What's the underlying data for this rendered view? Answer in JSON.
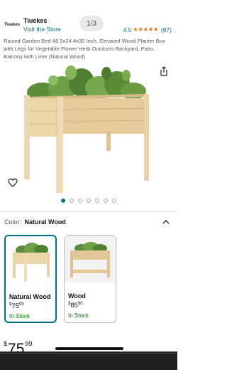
{
  "header": {
    "brand_logo_text": "Tiuekes",
    "brand_name": "Tiuekes",
    "visit_store": "Visit the Store",
    "image_counter": "1/3",
    "rating_value": "4.5",
    "rating_stars": 4.5,
    "rating_stars_glyphs": "★★★★★",
    "rating_count": "(87)"
  },
  "product": {
    "title": "Raised Garden Bed 48.5x24.4x30 Inch, Elevated Wood Planter Box with Legs for Vegetable Flower Herb Outdoors Backyard, Patio, Balcony with Liner (Natural Wood)"
  },
  "gallery": {
    "dot_count": 7,
    "active_index": 0
  },
  "color_selector": {
    "label": "Color:",
    "selected": "Natural Wood",
    "options": [
      {
        "name": "Natural Wood",
        "price_dollars": "75",
        "price_cents": "99",
        "currency": "$",
        "stock": "In Stock",
        "selected": true
      },
      {
        "name": "Wood",
        "price_dollars": "85",
        "price_cents": "90",
        "currency": "$",
        "stock": "In Stock",
        "selected": false
      }
    ]
  },
  "price": {
    "currency": "$",
    "dollars": "75",
    "cents": "99"
  },
  "colors": {
    "link": "#007185",
    "star": "#de7921",
    "in_stock": "#007600",
    "wood": "#e9d3a6",
    "wood_dark": "#c9ab78"
  },
  "icons": {
    "share": "share-icon",
    "wishlist": "heart-icon",
    "collapse": "chevron-up-icon"
  }
}
